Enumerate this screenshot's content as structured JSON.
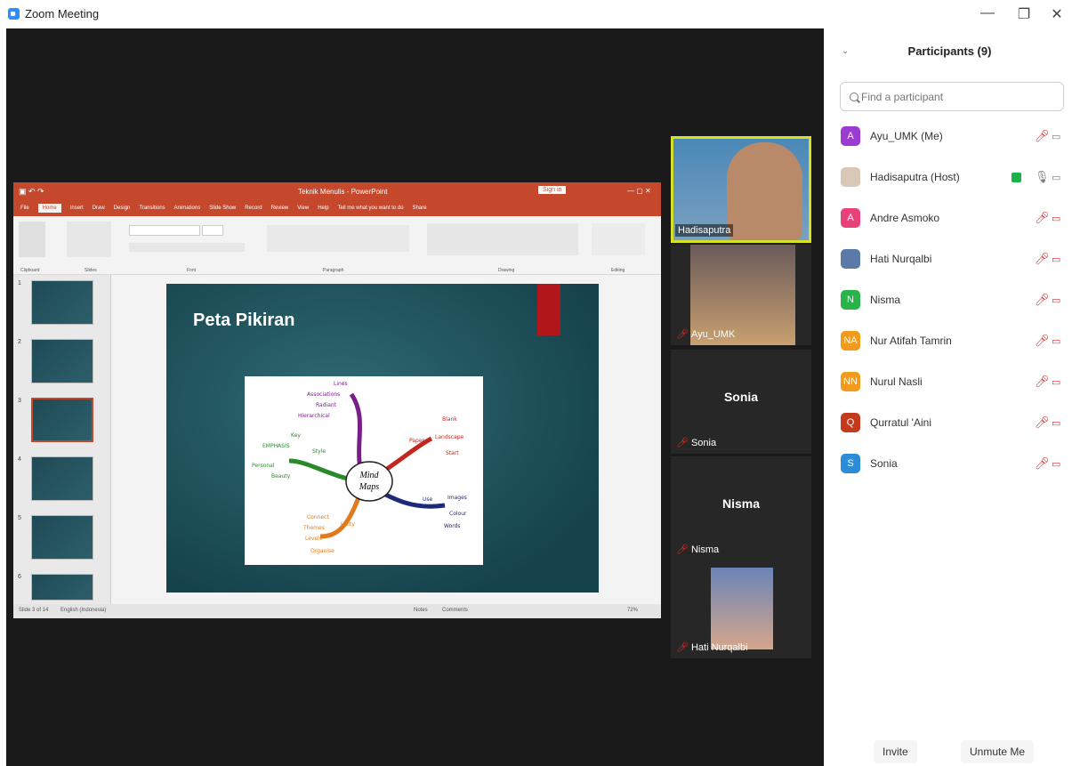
{
  "window": {
    "title": "Zoom Meeting",
    "minimize": "—",
    "restore": "❐",
    "close": "✕"
  },
  "ppt": {
    "title": "Teknik Menulis - PowerPoint",
    "sign_in": "Sign in",
    "tabs": [
      "File",
      "Home",
      "Insert",
      "Draw",
      "Design",
      "Transitions",
      "Animations",
      "Slide Show",
      "Record",
      "Review",
      "View",
      "Help",
      "Tell me what you want to do",
      "Share"
    ],
    "groups": [
      "Clipboard",
      "Slides",
      "Font",
      "Paragraph",
      "Drawing",
      "Editing"
    ],
    "slide_numbers": [
      "1",
      "2",
      "3",
      "4",
      "5",
      "6"
    ],
    "slide_title": "Peta Pikiran",
    "mindmap_center": "Mind Maps",
    "mindmap_words": [
      "Lines",
      "Associations",
      "Radiant",
      "Hierarchical",
      "Structure",
      "Key",
      "Emphasis",
      "Style",
      "Personal",
      "Beauty",
      "Paper",
      "Blank",
      "Landscape",
      "Start",
      "Use",
      "Images",
      "Colour",
      "Words",
      "Connect",
      "Themes",
      "Levels",
      "Organise",
      "Unity"
    ],
    "status_left": "Slide 3 of 14",
    "status_lang": "English (Indonesia)",
    "notes": "Notes",
    "comments": "Comments",
    "zoom": "72%"
  },
  "video_tiles": [
    {
      "name": "Hadisaputra",
      "active": true
    },
    {
      "name": "Ayu_UMK"
    },
    {
      "name": "Sonia",
      "big": "Sonia"
    },
    {
      "name": "Nisma",
      "big": "Nisma"
    },
    {
      "name": "Hati Nurqalbi"
    }
  ],
  "panel": {
    "title": "Participants (9)",
    "search_placeholder": "Find a participant",
    "invite": "Invite",
    "unmute": "Unmute Me",
    "participants": [
      {
        "initial": "A",
        "name": "Ayu_UMK (Me)",
        "color": "#9b3bd1"
      },
      {
        "initial": "",
        "name": "Hadisaputra (Host)",
        "color": "#d9c7b8"
      },
      {
        "initial": "A",
        "name": "Andre Asmoko",
        "color": "#e8417a"
      },
      {
        "initial": "",
        "name": "Hati Nurqalbi",
        "color": "#5a7aa8"
      },
      {
        "initial": "N",
        "name": "Nisma",
        "color": "#2ab34a"
      },
      {
        "initial": "NA",
        "name": "Nur Atifah Tamrin",
        "color": "#f29a1c"
      },
      {
        "initial": "NN",
        "name": "Nurul Nasli",
        "color": "#f29a1c"
      },
      {
        "initial": "Q",
        "name": "Qurratul 'Aini",
        "color": "#c33a1c"
      },
      {
        "initial": "S",
        "name": "Sonia",
        "color": "#2d8cd8"
      }
    ]
  }
}
